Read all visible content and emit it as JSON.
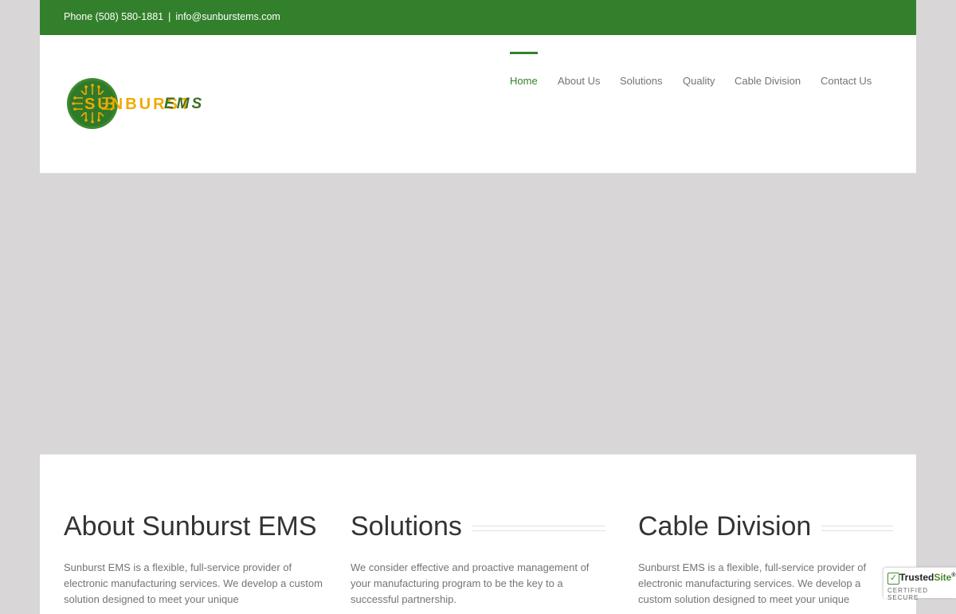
{
  "topbar": {
    "phone": "Phone (508) 580-1881",
    "separator": "|",
    "email": "info@sunburstems.com"
  },
  "logo": {
    "text_sun": "SUNBURST",
    "text_ems": "EMS",
    "colors": {
      "ring": "#33802c",
      "trace": "#f2a900",
      "ems": "#3b6f25"
    }
  },
  "nav": {
    "items": [
      {
        "label": "Home",
        "active": true
      },
      {
        "label": "About Us",
        "active": false
      },
      {
        "label": "Solutions",
        "active": false
      },
      {
        "label": "Quality",
        "active": false
      },
      {
        "label": "Cable Division",
        "active": false
      },
      {
        "label": "Contact Us",
        "active": false
      }
    ]
  },
  "columns": [
    {
      "title": "About Sunburst EMS",
      "text": "Sunburst EMS is a flexible, full-service provider of electronic manufacturing services. We develop a custom solution designed to meet your unique"
    },
    {
      "title": "Solutions",
      "text": "We consider effective and proactive management of your manufacturing program to be the key to a successful partnership."
    },
    {
      "title": "Cable Division",
      "text": "Sunburst EMS is a flexible, full-service provider of electronic manufacturing services. We develop a custom solution designed to meet your unique"
    }
  ],
  "badge": {
    "brand_a": "Trusted",
    "brand_b": "Site",
    "tm": "®",
    "sub": "CERTIFIED SECURE"
  },
  "theme": {
    "green": "#33802c",
    "page_bg": "#d8d6d7",
    "nav_text": "#747474"
  }
}
